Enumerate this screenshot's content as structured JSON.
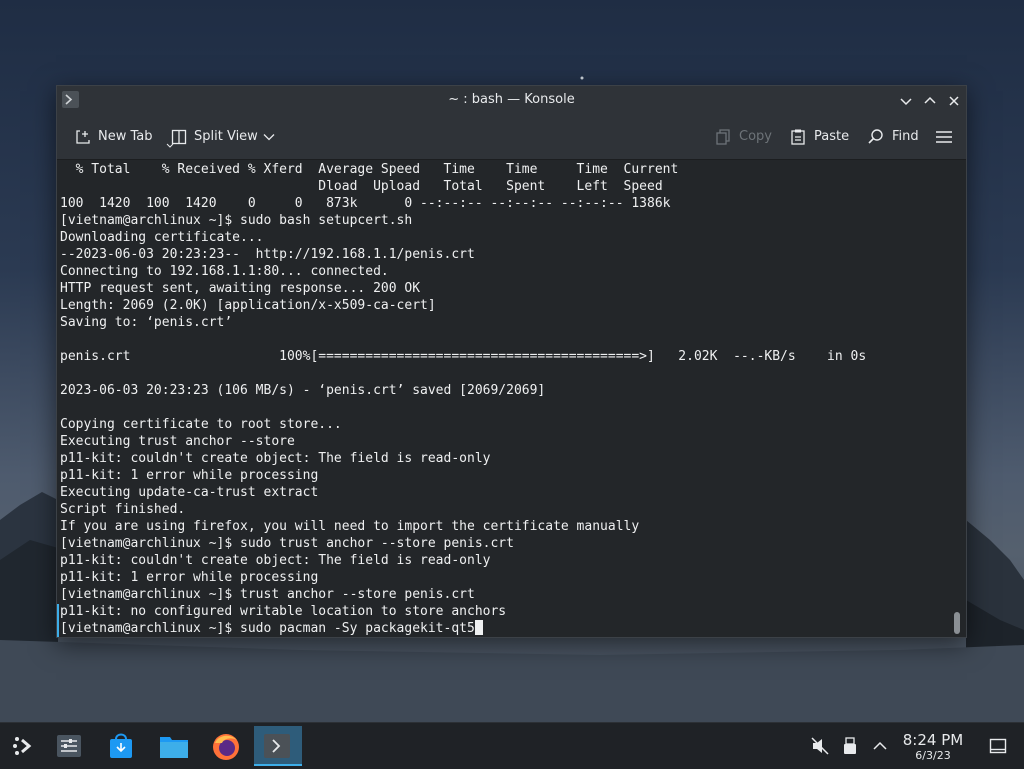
{
  "window": {
    "title": "~ : bash — Konsole",
    "controls": [
      "minimize",
      "maximize",
      "close"
    ]
  },
  "toolbar": {
    "new_tab": "New Tab",
    "split_view": "Split View",
    "copy": "Copy",
    "paste": "Paste",
    "find": "Find",
    "menu_icon": "hamburger-menu-icon"
  },
  "terminal": {
    "lines": [
      "  % Total    % Received % Xferd  Average Speed   Time    Time     Time  Current",
      "                                 Dload  Upload   Total   Spent    Left  Speed",
      "100  1420  100  1420    0     0   873k      0 --:--:-- --:--:-- --:--:-- 1386k",
      "[vietnam@archlinux ~]$ sudo bash setupcert.sh",
      "Downloading certificate...",
      "--2023-06-03 20:23:23--  http://192.168.1.1/penis.crt",
      "Connecting to 192.168.1.1:80... connected.",
      "HTTP request sent, awaiting response... 200 OK",
      "Length: 2069 (2.0K) [application/x-x509-ca-cert]",
      "Saving to: ‘penis.crt’",
      "",
      "penis.crt                   100%[=========================================>]   2.02K  --.-KB/s    in 0s",
      "",
      "2023-06-03 20:23:23 (106 MB/s) - ‘penis.crt’ saved [2069/2069]",
      "",
      "Copying certificate to root store...",
      "Executing trust anchor --store",
      "p11-kit: couldn't create object: The field is read-only",
      "p11-kit: 1 error while processing",
      "Executing update-ca-trust extract",
      "Script finished.",
      "If you are using firefox, you will need to import the certificate manually",
      "[vietnam@archlinux ~]$ sudo trust anchor --store penis.crt",
      "p11-kit: couldn't create object: The field is read-only",
      "p11-kit: 1 error while processing",
      "[vietnam@archlinux ~]$ trust anchor --store penis.crt",
      "p11-kit: no configured writable location to store anchors"
    ],
    "current_prompt": "[vietnam@archlinux ~]$ sudo pacman -Sy packagekit-qt5"
  },
  "taskbar": {
    "apps": [
      "application-launcher-icon",
      "system-settings-icon",
      "discover-store-icon",
      "file-manager-icon",
      "firefox-icon",
      "konsole-icon"
    ],
    "tray": [
      "speaker-muted-icon",
      "usb-device-icon",
      "tray-expand-icon"
    ],
    "clock_time": "8:24 PM",
    "clock_date": "6/3/23",
    "show_desktop_icon": "show-desktop-icon"
  },
  "colors": {
    "accent": "#3daee9",
    "terminal_bg": "#232629",
    "terminal_fg": "#eff0f1"
  }
}
